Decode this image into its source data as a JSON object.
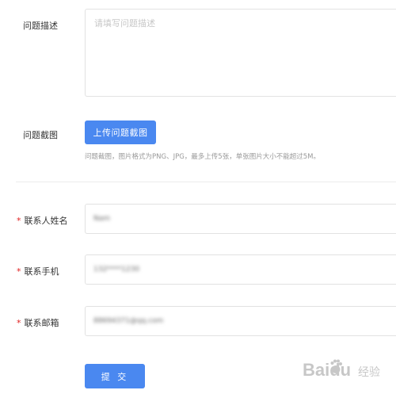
{
  "form": {
    "description": {
      "label": "问题描述",
      "placeholder": "请填写问题描述"
    },
    "screenshot": {
      "label": "问题截图",
      "upload_label": "上传问题截图",
      "hint": "问题截图，图片格式为PNG、JPG，最多上传5张，单张图片大小不能超过5M。"
    },
    "contact_name": {
      "required_mark": "*",
      "label": "联系人姓名",
      "value": "Nam"
    },
    "contact_phone": {
      "required_mark": "*",
      "label": "联系手机",
      "value": "132****1230"
    },
    "contact_email": {
      "required_mark": "*",
      "label": "联系邮箱",
      "value": "88694371@qq.com"
    },
    "submit_label": "提 交"
  },
  "colors": {
    "primary": "#4a88f0",
    "required": "#e02020"
  },
  "watermark": {
    "icon": "baidu-paw-icon",
    "brand": "Baidu",
    "tagline": "经验"
  }
}
